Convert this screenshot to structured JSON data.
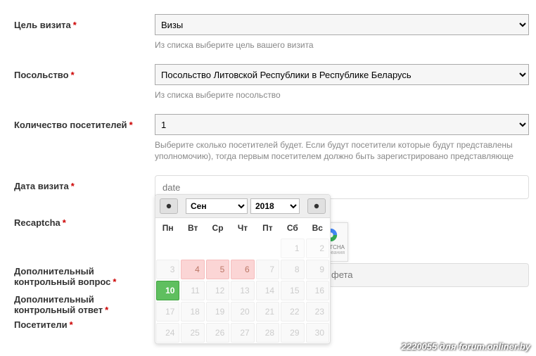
{
  "fields": {
    "purpose": {
      "label": "Цель визита",
      "value": "Визы",
      "hint": "Из списка выберите цель вашего визита"
    },
    "embassy": {
      "label": "Посольство",
      "value": "Посольство Литовской Республики в Республике Беларусь",
      "hint": "Из списка выберите посольство"
    },
    "visitors": {
      "label": "Количество посетителей",
      "value": "1",
      "hint": "Выберите сколько посетителей будет. Если будут посетители которые будут представлены уполномочию), тогда первым посетителем должно быть зарегистрировано представляюще"
    },
    "visit_date": {
      "label": "Дата визита",
      "placeholder": "date"
    },
    "recaptcha": {
      "label": "Recaptcha",
      "badge_line1": "PTCHA",
      "badge_line2": "ования"
    },
    "sec_question": {
      "label": "Дополнительный контрольный вопрос",
      "value": "фета"
    },
    "sec_answer": {
      "label": "Дополнительный контрольный ответ"
    },
    "visitors_section": {
      "label": "Посетители"
    }
  },
  "calendar": {
    "month": "Сен",
    "year": "2018",
    "weekdays": [
      "Пн",
      "Вт",
      "Ср",
      "Чт",
      "Пт",
      "Сб",
      "Вс"
    ],
    "prev_trailing": [
      1,
      2
    ],
    "days": [
      {
        "n": 3,
        "s": "disabled"
      },
      {
        "n": 4,
        "s": "pink"
      },
      {
        "n": 5,
        "s": "pink"
      },
      {
        "n": 6,
        "s": "pink"
      },
      {
        "n": 7,
        "s": "disabled"
      },
      {
        "n": 8,
        "s": "disabled"
      },
      {
        "n": 9,
        "s": "disabled"
      },
      {
        "n": 10,
        "s": "selected"
      },
      {
        "n": 11,
        "s": "disabled"
      },
      {
        "n": 12,
        "s": "disabled"
      },
      {
        "n": 13,
        "s": "disabled"
      },
      {
        "n": 14,
        "s": "disabled"
      },
      {
        "n": 15,
        "s": "disabled"
      },
      {
        "n": 16,
        "s": "disabled"
      },
      {
        "n": 17,
        "s": "disabled"
      },
      {
        "n": 18,
        "s": "disabled"
      },
      {
        "n": 19,
        "s": "disabled"
      },
      {
        "n": 20,
        "s": "disabled"
      },
      {
        "n": 21,
        "s": "disabled"
      },
      {
        "n": 22,
        "s": "disabled"
      },
      {
        "n": 23,
        "s": "disabled"
      },
      {
        "n": 24,
        "s": "disabled"
      },
      {
        "n": 25,
        "s": "disabled"
      },
      {
        "n": 26,
        "s": "disabled"
      },
      {
        "n": 27,
        "s": "disabled"
      },
      {
        "n": 28,
        "s": "disabled"
      },
      {
        "n": 29,
        "s": "disabled"
      },
      {
        "n": 30,
        "s": "disabled"
      }
    ]
  },
  "watermark": "2220055 для forum.onliner.by"
}
